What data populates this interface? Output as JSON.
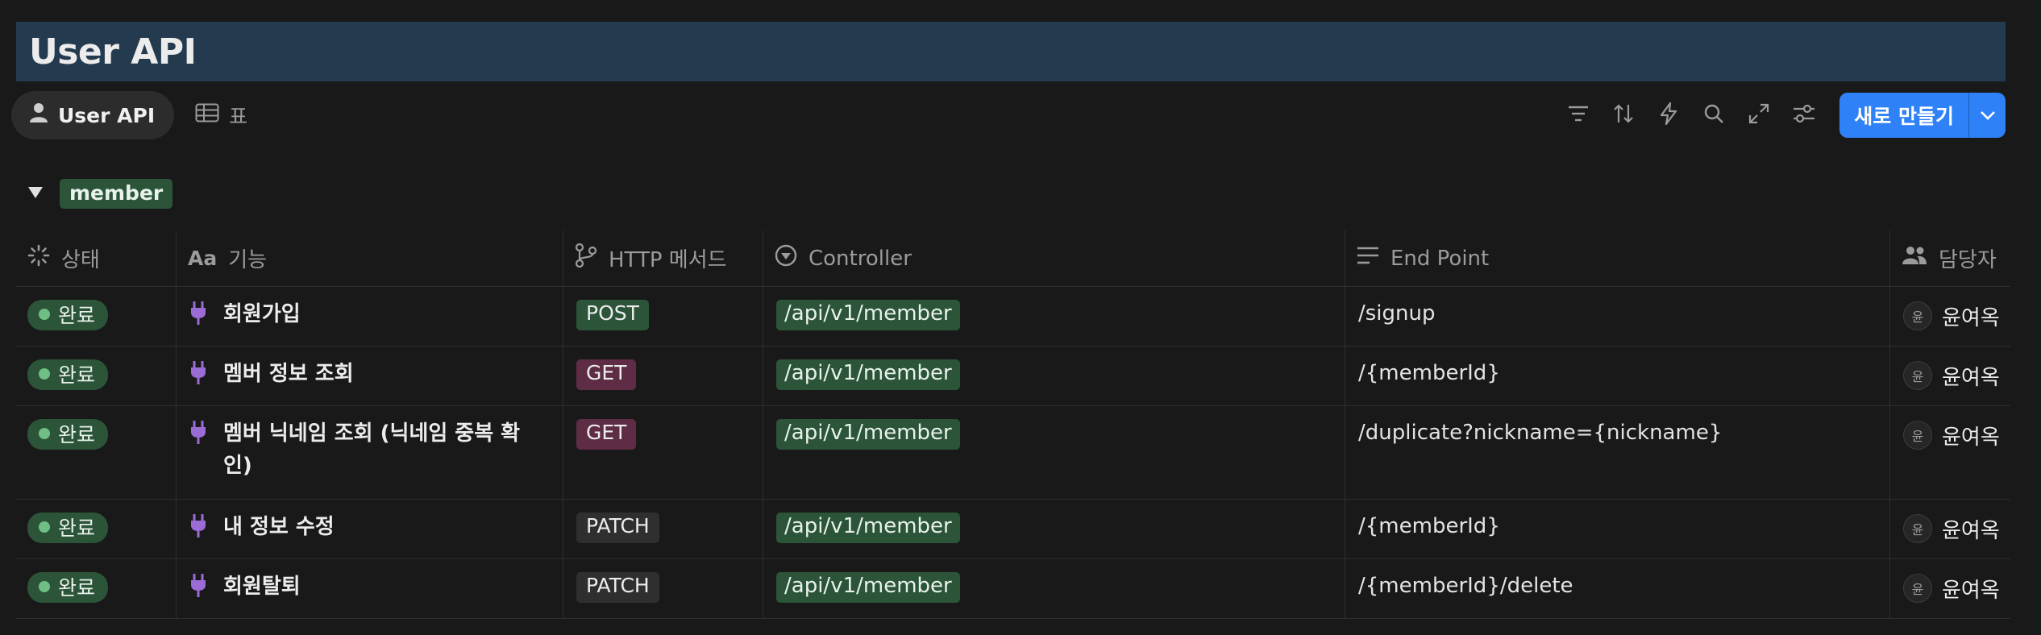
{
  "page": {
    "title": "User API"
  },
  "views": [
    {
      "label": "User API",
      "icon": "person-icon",
      "active": true
    },
    {
      "label": "표",
      "icon": "table-icon",
      "active": false
    }
  ],
  "toolbar": {
    "tools": [
      "filter-icon",
      "sort-icon",
      "automation-icon",
      "search-icon",
      "expand-icon",
      "settings-sliders-icon"
    ],
    "new_label": "새로 만들기"
  },
  "group": {
    "label": "member",
    "collapsed": false
  },
  "columns": [
    {
      "label": "상태",
      "icon": "status-icon"
    },
    {
      "label": "기능",
      "icon": "text-property-icon"
    },
    {
      "label": "HTTP 메서드",
      "icon": "branch-icon"
    },
    {
      "label": "Controller",
      "icon": "select-icon"
    },
    {
      "label": "End Point",
      "icon": "text-lines-icon"
    },
    {
      "label": "담당자",
      "icon": "people-icon"
    }
  ],
  "rows": [
    {
      "status": "완료",
      "feature": "회원가입",
      "method": "POST",
      "controller": "/api/v1/member",
      "endpoint": "/signup",
      "owner_initial": "윤",
      "owner": "윤여옥"
    },
    {
      "status": "완료",
      "feature": "멤버 정보 조회",
      "method": "GET",
      "controller": "/api/v1/member",
      "endpoint": "/{memberId}",
      "owner_initial": "윤",
      "owner": "윤여옥"
    },
    {
      "status": "완료",
      "feature_line1": "멤버 닉네임 조회 (닉네임 중복 확",
      "feature_line2": "인)",
      "method": "GET",
      "controller": "/api/v1/member",
      "endpoint": "/duplicate?nickname={nickname}",
      "owner_initial": "윤",
      "owner": "윤여옥"
    },
    {
      "status": "완료",
      "feature": "내 정보 수정",
      "method": "PATCH",
      "controller": "/api/v1/member",
      "endpoint": "/{memberId}",
      "owner_initial": "윤",
      "owner": "윤여옥"
    },
    {
      "status": "완료",
      "feature": "회원탈퇴",
      "method": "PATCH",
      "controller": "/api/v1/member",
      "endpoint": "/{memberId}/delete",
      "owner_initial": "윤",
      "owner": "윤여옥"
    }
  ],
  "colors": {
    "accent": "#2f81f7",
    "green_tag": "#2b5438",
    "get_tag": "#5e2c44",
    "title_bg": "#233a4f",
    "plug": "#9b6bd6"
  }
}
